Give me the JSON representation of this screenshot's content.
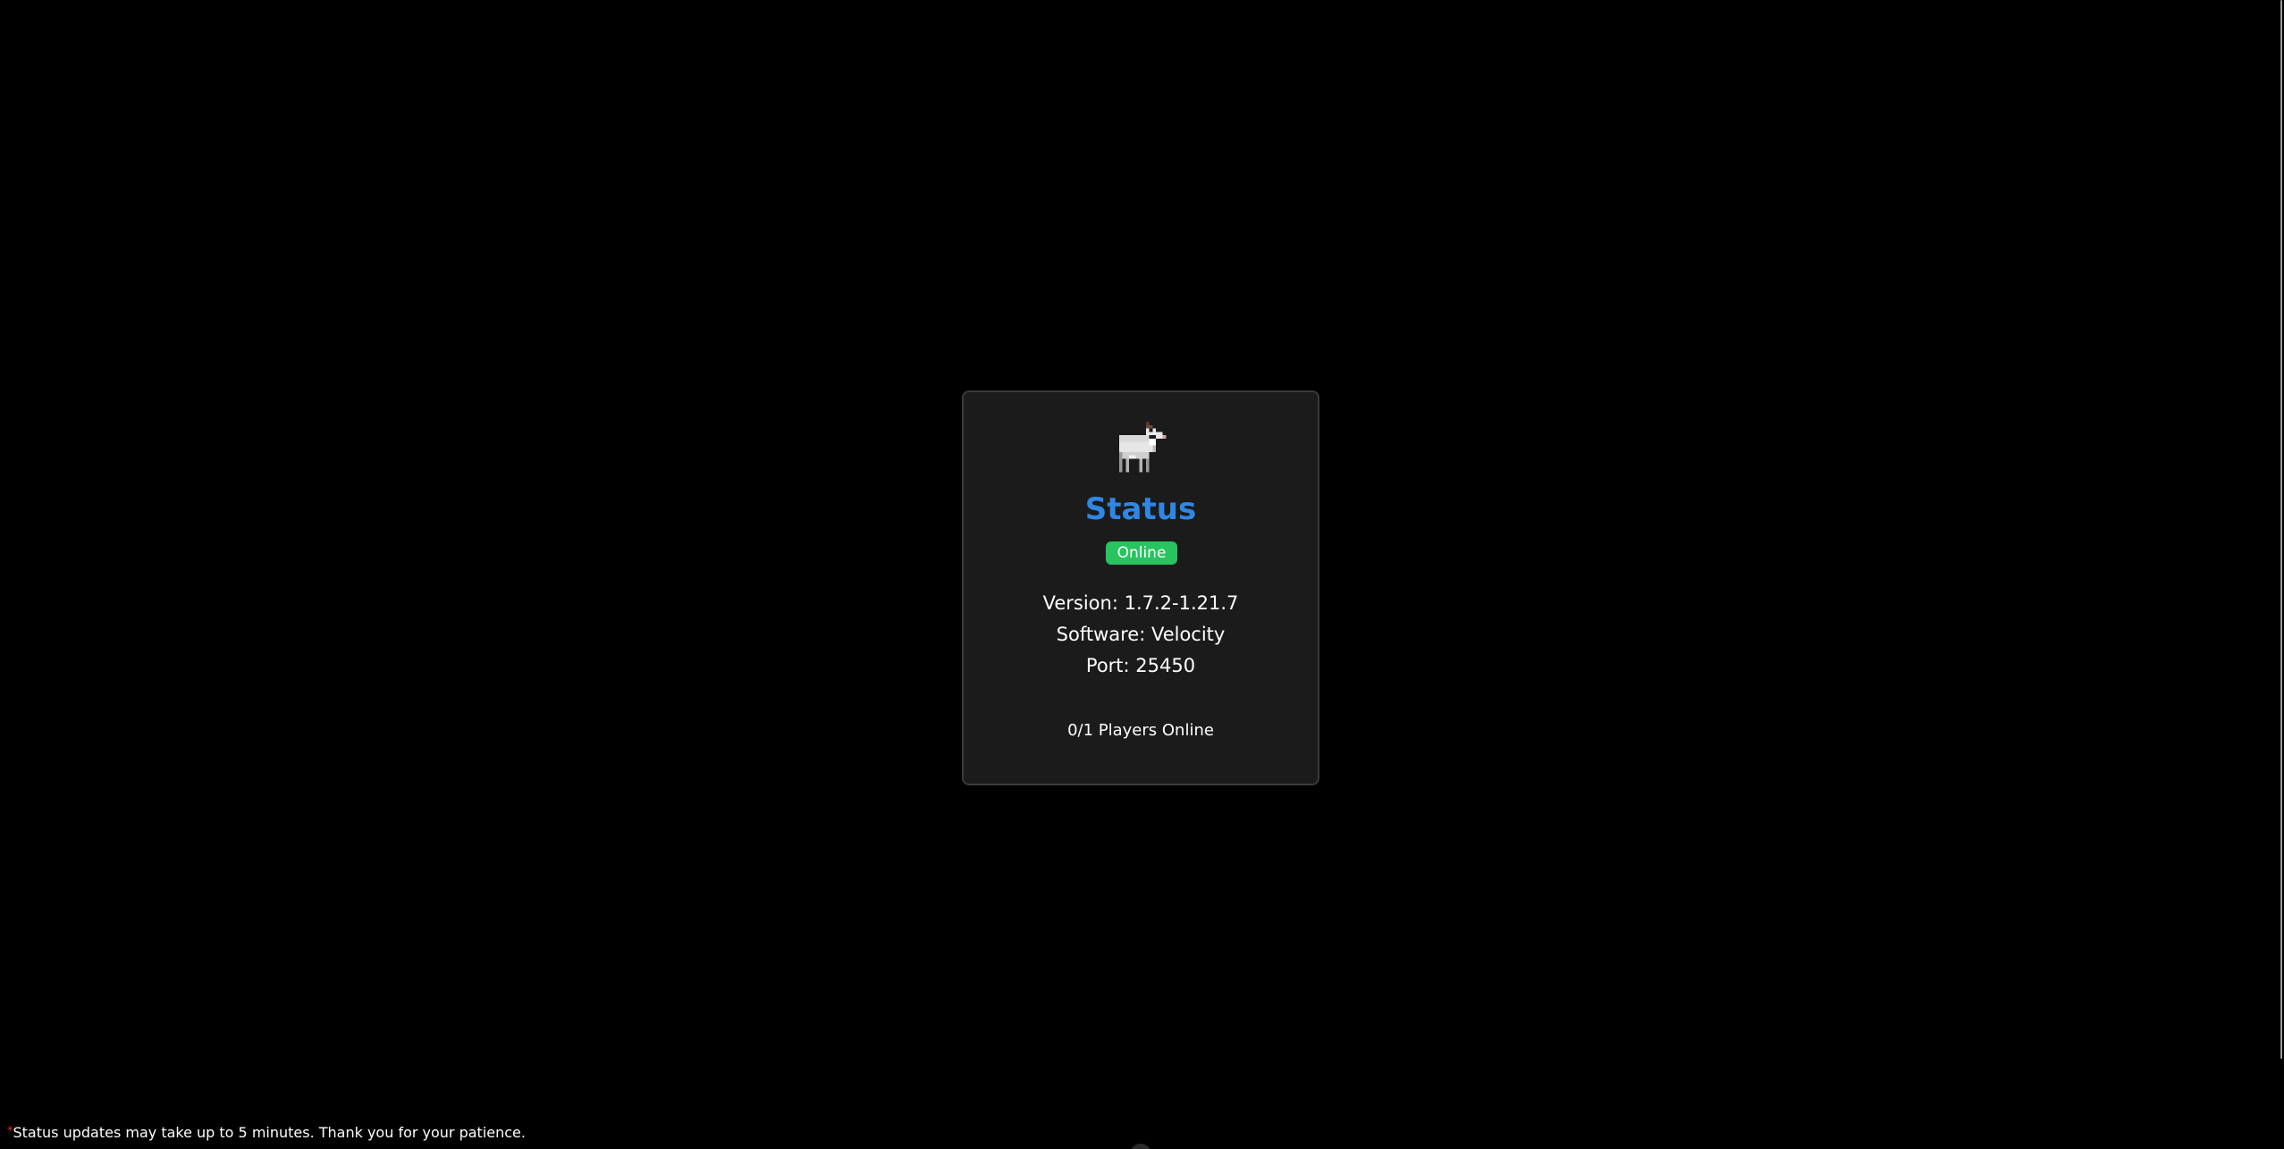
{
  "card": {
    "icon": "goat-pixel-icon",
    "title": "Status",
    "status_badge": "Online",
    "version": "Version: 1.7.2-1.21.7",
    "software": "Software: Velocity",
    "port": "Port: 25450",
    "players": "0/1 Players Online"
  },
  "footer": {
    "asterisk": "*",
    "note": "Status updates may take up to 5 minutes. Thank you for your patience."
  },
  "colors": {
    "background": "#000000",
    "card": "#1b1b1b",
    "title": "#2f86e3",
    "online": "#27c460",
    "asterisk": "#e02828"
  }
}
